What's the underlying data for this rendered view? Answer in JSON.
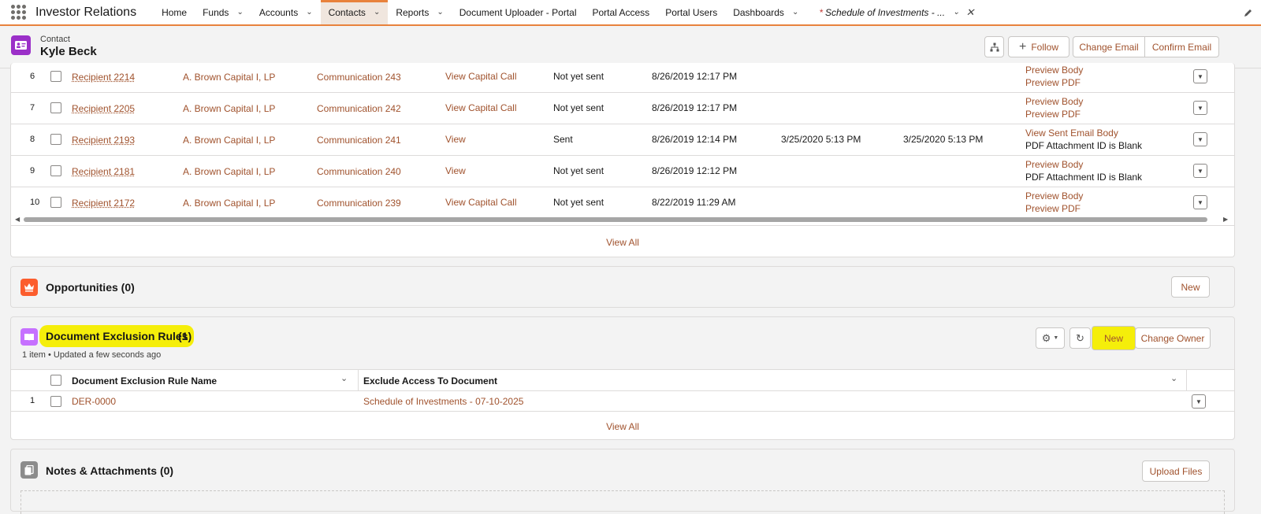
{
  "app": {
    "name": "Investor Relations"
  },
  "nav": {
    "items": [
      {
        "label": "Home",
        "dropdown": false,
        "active": false
      },
      {
        "label": "Funds",
        "dropdown": true,
        "active": false
      },
      {
        "label": "Accounts",
        "dropdown": true,
        "active": false
      },
      {
        "label": "Contacts",
        "dropdown": true,
        "active": true
      },
      {
        "label": "Reports",
        "dropdown": true,
        "active": false
      },
      {
        "label": "Document Uploader - Portal",
        "dropdown": false,
        "active": false
      },
      {
        "label": "Portal Access",
        "dropdown": false,
        "active": false
      },
      {
        "label": "Portal Users",
        "dropdown": false,
        "active": false
      },
      {
        "label": "Dashboards",
        "dropdown": true,
        "active": false
      }
    ],
    "open_tab": {
      "marker": "*",
      "label": "Schedule of Investments - ..."
    }
  },
  "record": {
    "type": "Contact",
    "name": "Kyle Beck",
    "buttons": {
      "follow": "Follow",
      "change_email": "Change Email",
      "confirm_email": "Confirm Email"
    }
  },
  "communications": {
    "rows": [
      {
        "num": "6",
        "recipient": "Recipient 2214",
        "account": "A. Brown Capital I, LP",
        "communication": "Communication 243",
        "view": "View Capital Call",
        "status": "Not yet sent",
        "created": "8/26/2019 12:17 PM",
        "sent": "",
        "opened": "",
        "link1": "Preview Body",
        "link1_is_link": true,
        "link2": "Preview PDF",
        "link2_is_link": true
      },
      {
        "num": "7",
        "recipient": "Recipient 2205",
        "account": "A. Brown Capital I, LP",
        "communication": "Communication 242",
        "view": "View Capital Call",
        "status": "Not yet sent",
        "created": "8/26/2019 12:17 PM",
        "sent": "",
        "opened": "",
        "link1": "Preview Body",
        "link1_is_link": true,
        "link2": "Preview PDF",
        "link2_is_link": true
      },
      {
        "num": "8",
        "recipient": "Recipient 2193",
        "account": "A. Brown Capital I, LP",
        "communication": "Communication 241",
        "view": "View",
        "status": "Sent",
        "created": "8/26/2019 12:14 PM",
        "sent": "3/25/2020 5:13 PM",
        "opened": "3/25/2020 5:13 PM",
        "link1": "View Sent Email Body",
        "link1_is_link": true,
        "link2": "PDF Attachment ID is Blank",
        "link2_is_link": false
      },
      {
        "num": "9",
        "recipient": "Recipient 2181",
        "account": "A. Brown Capital I, LP",
        "communication": "Communication 240",
        "view": "View",
        "status": "Not yet sent",
        "created": "8/26/2019 12:12 PM",
        "sent": "",
        "opened": "",
        "link1": "Preview Body",
        "link1_is_link": true,
        "link2": "PDF Attachment ID is Blank",
        "link2_is_link": false
      },
      {
        "num": "10",
        "recipient": "Recipient 2172",
        "account": "A. Brown Capital I, LP",
        "communication": "Communication 239",
        "view": "View Capital Call",
        "status": "Not yet sent",
        "created": "8/22/2019 11:29 AM",
        "sent": "",
        "opened": "",
        "link1": "Preview Body",
        "link1_is_link": true,
        "link2": "Preview PDF",
        "link2_is_link": true
      }
    ],
    "view_all": "View All"
  },
  "opportunities": {
    "title": "Opportunities (0)",
    "new_button": "New"
  },
  "exclusion_rules": {
    "title": "Document Exclusion Rules",
    "count": "(1)",
    "subtitle": "1 item • Updated a few seconds ago",
    "new_button": "New",
    "change_owner_button": "Change Owner",
    "columns": [
      "Document Exclusion Rule Name",
      "Exclude Access To Document"
    ],
    "rows": [
      {
        "num": "1",
        "name": "DER-0000",
        "document": "Schedule of Investments - 07-10-2025"
      }
    ],
    "view_all": "View All"
  },
  "notes": {
    "title": "Notes & Attachments (0)",
    "upload_button": "Upload Files"
  },
  "colors": {
    "accent": "#e8823c",
    "link": "#a0522d",
    "highlight": "#f5ee0a",
    "contact_icon": "#9b30c8",
    "opportunity_icon": "#fc5d2d",
    "rule_icon": "#c671ff",
    "notes_icon": "#8c8c8c"
  }
}
